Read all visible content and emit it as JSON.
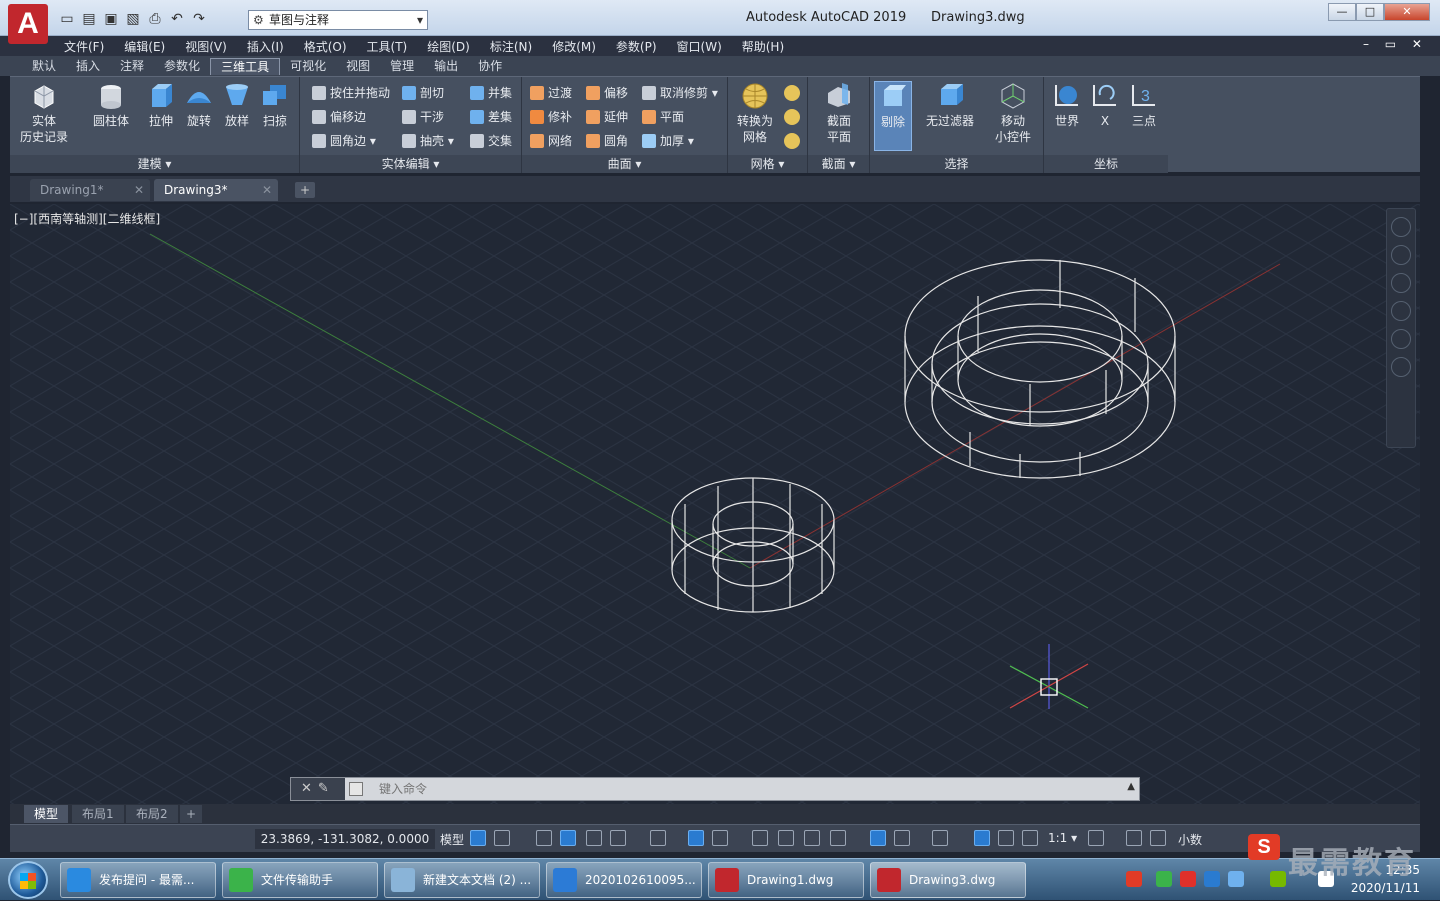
{
  "title_bar": {
    "app_title": "Autodesk AutoCAD 2019",
    "document_title": "Drawing3.dwg",
    "workspace": "草图与注释",
    "logo_letter": "A",
    "minimize": "—",
    "maximize": "□",
    "close": "✕"
  },
  "menubar": {
    "items": [
      "文件(F)",
      "编辑(E)",
      "视图(V)",
      "插入(I)",
      "格式(O)",
      "工具(T)",
      "绘图(D)",
      "标注(N)",
      "修改(M)",
      "参数(P)",
      "窗口(W)",
      "帮助(H)"
    ],
    "doc_controls": "– ▭ ✕"
  },
  "ribbon_tabs": [
    "默认",
    "插入",
    "注释",
    "参数化",
    "三维工具",
    "可视化",
    "视图",
    "管理",
    "输出",
    "协作"
  ],
  "ribbon_tabs_active": "三维工具",
  "ribbon": {
    "modeling": {
      "title": "建模 ▾",
      "buttons": [
        "实体\n历史记录",
        "圆柱体",
        "拉伸",
        "旋转",
        "放样",
        "扫掠"
      ]
    },
    "solid_edit": {
      "title": "实体编辑 ▾",
      "buttons": [
        "按住并拖动",
        "偏移边",
        "圆角边 ▾",
        "剖切",
        "干涉",
        "抽壳 ▾",
        "并集",
        "差集",
        "交集"
      ]
    },
    "surface": {
      "title": "曲面 ▾",
      "buttons": [
        "过渡",
        "修补",
        "网络",
        "偏移",
        "延伸",
        "圆角",
        "取消修剪 ▾",
        "平面",
        "加厚 ▾"
      ]
    },
    "mesh": {
      "title": "网格 ▾",
      "buttons": [
        "转换为\n网格"
      ]
    },
    "section": {
      "title": "截面 ▾",
      "buttons": [
        "截面\n平面"
      ]
    },
    "selection": {
      "title": "选择",
      "buttons": [
        "剔除",
        "无过滤器",
        "移动\n小控件"
      ]
    },
    "coordinates": {
      "title": "坐标",
      "buttons": [
        "世界",
        "X",
        "三点"
      ]
    }
  },
  "doc_tabs": [
    {
      "label": "Drawing1*",
      "active": false
    },
    {
      "label": "Drawing3*",
      "active": true
    }
  ],
  "new_tab": "+",
  "viewport": {
    "label": "[−][西南等轴测][二维线框]"
  },
  "command_line": {
    "placeholder": "键入命令"
  },
  "layout_tabs": [
    "模型",
    "布局1",
    "布局2"
  ],
  "layout_add": "+",
  "statusbar": {
    "coordinates": "23.3869, -131.3082, 0.0000",
    "model": "模型",
    "scale": "1:1 ▾",
    "units": "小数"
  },
  "taskbar": {
    "items": [
      {
        "label": "发布提问 - 最需..."
      },
      {
        "label": "文件传输助手"
      },
      {
        "label": "新建文本文档 (2) ..."
      },
      {
        "label": "2020102610095..."
      },
      {
        "label": "Drawing1.dwg"
      },
      {
        "label": "Drawing3.dwg"
      }
    ],
    "time": "12:35",
    "date": "2020/11/11"
  },
  "watermark": {
    "text": "最需教育",
    "logo": "S"
  },
  "colors": {
    "accent": "#c1272d",
    "viewport_bg": "#212835",
    "ribbon_bg": "#465060"
  }
}
